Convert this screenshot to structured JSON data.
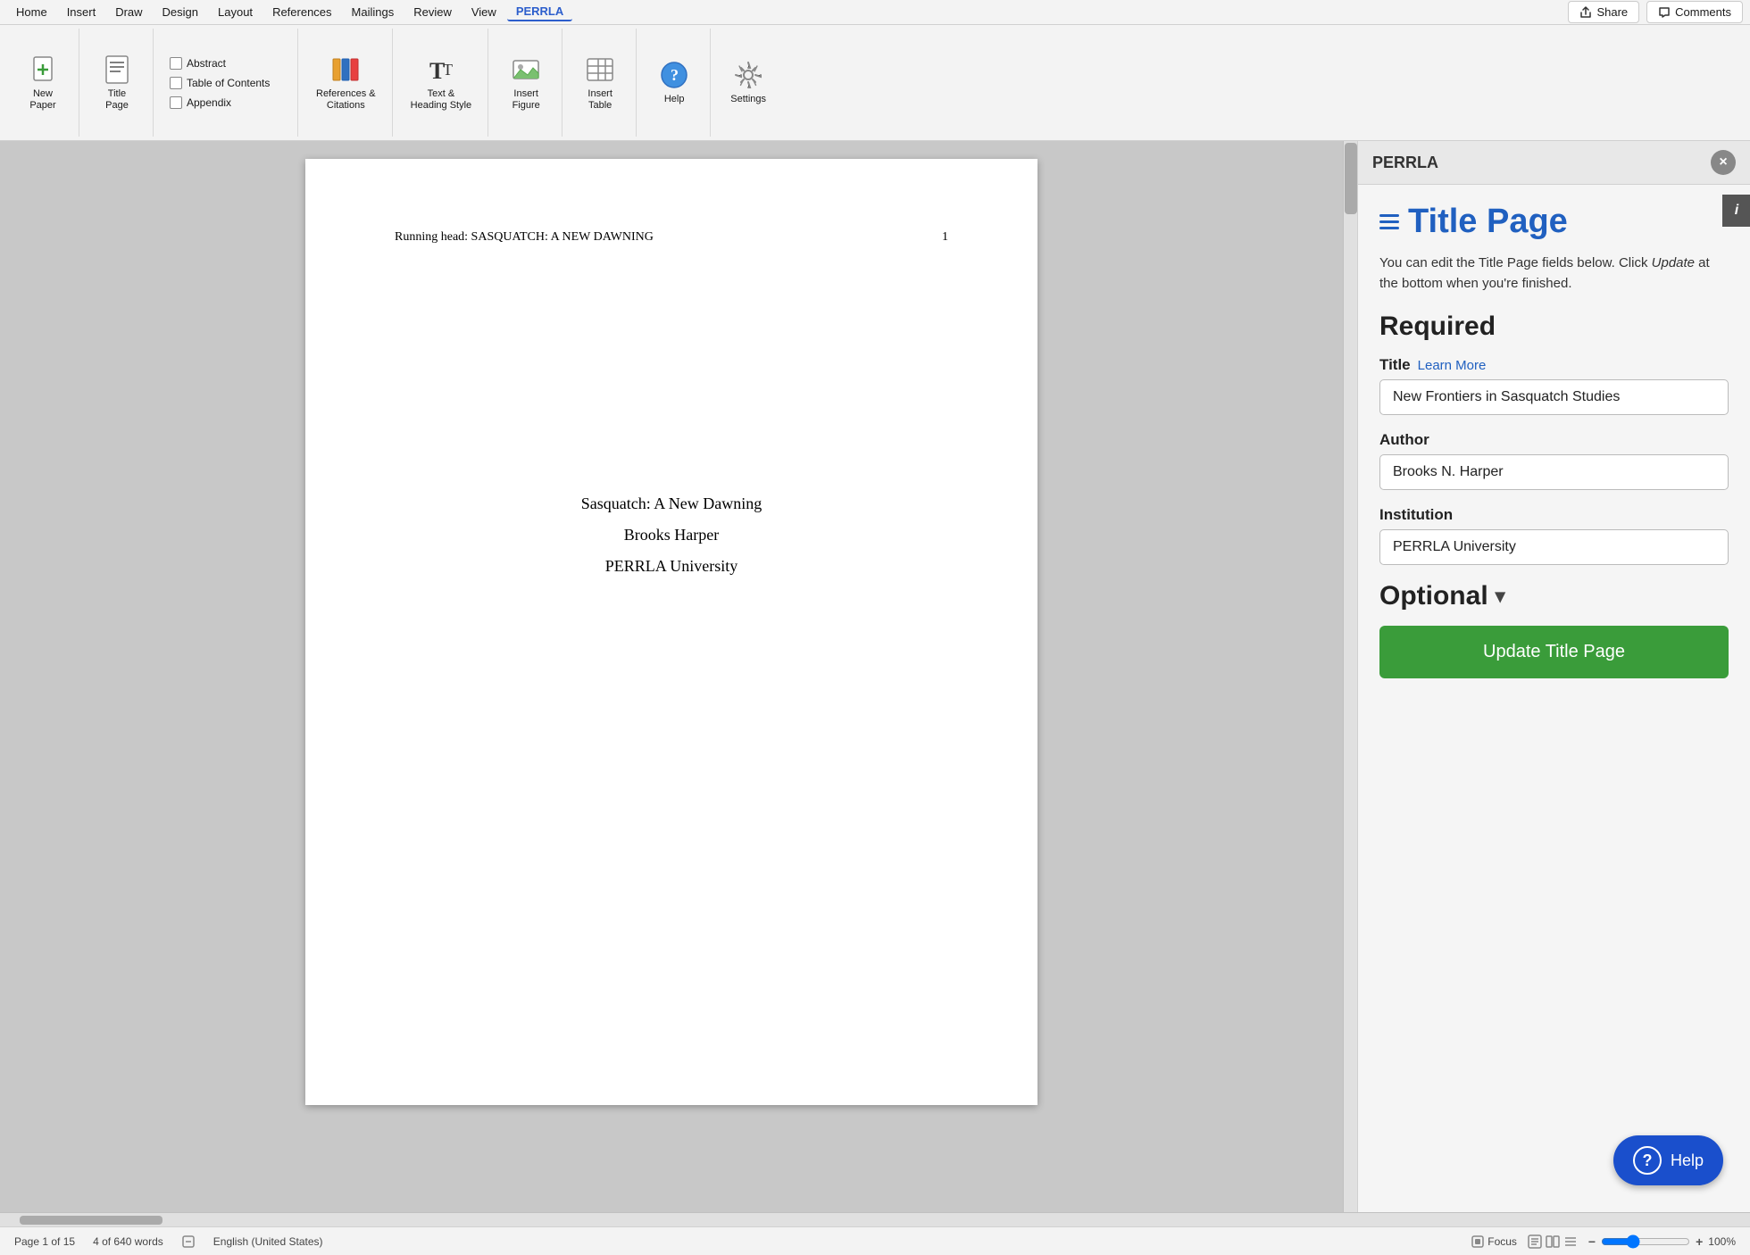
{
  "menubar": {
    "items": [
      "Home",
      "Insert",
      "Draw",
      "Design",
      "Layout",
      "References",
      "Mailings",
      "Review",
      "View",
      "PERRLA"
    ],
    "active": "PERRLA",
    "share_label": "Share",
    "comments_label": "Comments"
  },
  "ribbon": {
    "new_paper_label": "New\nPaper",
    "title_page_label": "Title\nPage",
    "abstract_label": "Abstract",
    "table_of_contents_label": "Table of Contents",
    "appendix_label": "Appendix",
    "references_citations_label": "References &\nCitations",
    "text_heading_label": "Text &\nHeading Style",
    "insert_figure_label": "Insert\nFigure",
    "insert_table_label": "Insert\nTable",
    "help_label": "Help",
    "settings_label": "Settings"
  },
  "document": {
    "running_head": "Running head: SASQUATCH: A NEW DAWNING",
    "page_number": "1",
    "title": "Sasquatch: A New Dawning",
    "author": "Brooks Harper",
    "institution": "PERRLA University"
  },
  "panel": {
    "header_title": "PERRLA",
    "close_label": "×",
    "info_label": "i",
    "section_title": "Title Page",
    "description_part1": "You can edit the Title Page fields below. Click ",
    "description_italic": "Update",
    "description_part2": " at the bottom when you're finished.",
    "required_heading": "Required",
    "title_label": "Title",
    "learn_more_label": "Learn More",
    "title_value": "New Frontiers in Sasquatch Studies",
    "author_label": "Author",
    "author_value": "Brooks N. Harper",
    "institution_label": "Institution",
    "institution_value": "PERRLA University",
    "optional_heading": "Optional",
    "update_btn_label": "Update Title Page",
    "help_btn_label": "Help"
  },
  "statusbar": {
    "page_info": "Page 1 of 15",
    "word_count": "4 of 640 words",
    "language": "English (United States)",
    "focus_label": "Focus",
    "zoom_level": "100%"
  }
}
